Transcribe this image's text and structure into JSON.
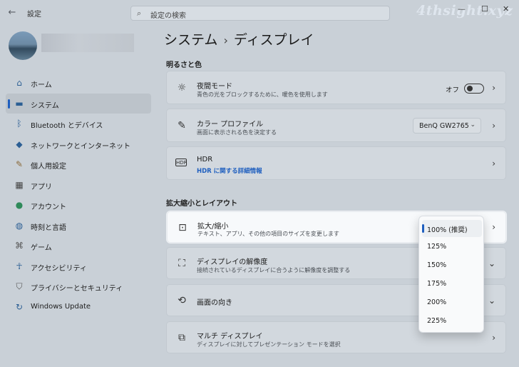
{
  "titlebar": {
    "back": "←",
    "title": "設定",
    "search_placeholder": "設定の検索",
    "watermark": "4thsight.xyz",
    "minimize": "—",
    "maximize": "☐",
    "close": "✕"
  },
  "sidebar": {
    "items": [
      {
        "label": "ホーム",
        "icon": "home-icon"
      },
      {
        "label": "システム",
        "icon": "system-icon"
      },
      {
        "label": "Bluetooth とデバイス",
        "icon": "bluetooth-icon"
      },
      {
        "label": "ネットワークとインターネット",
        "icon": "network-icon"
      },
      {
        "label": "個人用設定",
        "icon": "brush-icon"
      },
      {
        "label": "アプリ",
        "icon": "apps-icon"
      },
      {
        "label": "アカウント",
        "icon": "account-icon"
      },
      {
        "label": "時刻と言語",
        "icon": "globe-icon"
      },
      {
        "label": "ゲーム",
        "icon": "gamepad-icon"
      },
      {
        "label": "アクセシビリティ",
        "icon": "accessibility-icon"
      },
      {
        "label": "プライバシーとセキュリティ",
        "icon": "shield-icon"
      },
      {
        "label": "Windows Update",
        "icon": "update-icon"
      }
    ],
    "active_index": 1
  },
  "main": {
    "breadcrumb_parent": "システム",
    "breadcrumb_sep": "›",
    "breadcrumb_current": "ディスプレイ",
    "section1": "明るさと色",
    "night_light": {
      "title": "夜間モード",
      "desc": "青色の光をブロックするために、暖色を使用します",
      "toggle_label": "オフ"
    },
    "color_profile": {
      "title": "カラー プロファイル",
      "desc": "画面に表示される色を決定する",
      "value": "BenQ GW2765"
    },
    "hdr": {
      "title": "HDR",
      "link": "HDR に関する詳細情報"
    },
    "section2": "拡大縮小とレイアウト",
    "scale": {
      "title": "拡大/縮小",
      "desc": "テキスト、アプリ、その他の項目のサイズを変更します"
    },
    "resolution": {
      "title": "ディスプレイの解像度",
      "desc": "接続されているディスプレイに合うように解像度を調整する"
    },
    "orientation": {
      "title": "画面の向き"
    },
    "multi": {
      "title": "マルチ ディスプレイ",
      "desc": "ディスプレイに対してプレゼンテーション モードを選択"
    }
  },
  "flyout": {
    "options": [
      "100% (推奨)",
      "125%",
      "150%",
      "175%",
      "200%",
      "225%"
    ],
    "selected_index": 0
  },
  "colors": {
    "accent": "#1f5fbf"
  }
}
